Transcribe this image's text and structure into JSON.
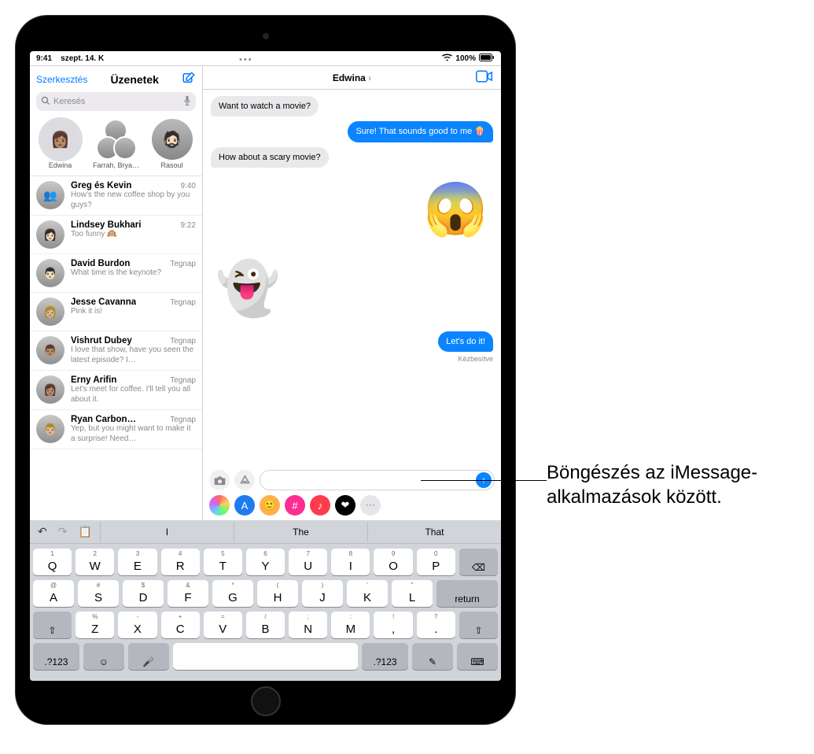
{
  "status": {
    "time": "9:41",
    "date": "szept. 14. K",
    "battery": "100%"
  },
  "sidebar": {
    "edit": "Szerkesztés",
    "title": "Üzenetek",
    "search_placeholder": "Keresés"
  },
  "pinned": [
    {
      "name": "Edwina"
    },
    {
      "name": "Farrah, Brya…"
    },
    {
      "name": "Rasoul"
    }
  ],
  "conversations": [
    {
      "name": "Greg és Kevin",
      "time": "9:40",
      "preview": "How's the new coffee shop by you guys?"
    },
    {
      "name": "Lindsey Bukhari",
      "time": "9:22",
      "preview": "Too funny 🙉"
    },
    {
      "name": "David Burdon",
      "time": "Tegnap",
      "preview": "What time is the keynote?"
    },
    {
      "name": "Jesse Cavanna",
      "time": "Tegnap",
      "preview": "Pink it is!"
    },
    {
      "name": "Vishrut Dubey",
      "time": "Tegnap",
      "preview": "I love that show, have you seen the latest episode? I…"
    },
    {
      "name": "Erny Arifin",
      "time": "Tegnap",
      "preview": "Let's meet for coffee. I'll tell you all about it."
    },
    {
      "name": "Ryan Carbon…",
      "time": "Tegnap",
      "preview": "Yep, but you might want to make it a surprise! Need…"
    }
  ],
  "thread": {
    "title": "Edwina",
    "messages": {
      "m0": "Want to watch a movie?",
      "m1": "Sure! That sounds good to me 🍿",
      "m2": "How about a scary movie?",
      "m3": "Let's do it!"
    },
    "delivered": "Kézbesítve"
  },
  "predict": {
    "p0": "I",
    "p1": "The",
    "p2": "That"
  },
  "keyboard": {
    "row1": [
      {
        "main": "Q",
        "alt": "1"
      },
      {
        "main": "W",
        "alt": "2"
      },
      {
        "main": "E",
        "alt": "3"
      },
      {
        "main": "R",
        "alt": "4"
      },
      {
        "main": "T",
        "alt": "5"
      },
      {
        "main": "Y",
        "alt": "6"
      },
      {
        "main": "U",
        "alt": "7"
      },
      {
        "main": "I",
        "alt": "8"
      },
      {
        "main": "O",
        "alt": "9"
      },
      {
        "main": "P",
        "alt": "0"
      }
    ],
    "row2": [
      {
        "main": "A",
        "alt": "@"
      },
      {
        "main": "S",
        "alt": "#"
      },
      {
        "main": "D",
        "alt": "$"
      },
      {
        "main": "F",
        "alt": "&"
      },
      {
        "main": "G",
        "alt": "*"
      },
      {
        "main": "H",
        "alt": "("
      },
      {
        "main": "J",
        "alt": ")"
      },
      {
        "main": "K",
        "alt": "'"
      },
      {
        "main": "L",
        "alt": "\""
      }
    ],
    "row3": [
      {
        "main": "Z",
        "alt": "%"
      },
      {
        "main": "X",
        "alt": "-"
      },
      {
        "main": "C",
        "alt": "+"
      },
      {
        "main": "V",
        "alt": "="
      },
      {
        "main": "B",
        "alt": "/"
      },
      {
        "main": "N",
        "alt": ";"
      },
      {
        "main": "M",
        "alt": ":"
      }
    ],
    "return": "return",
    "numkey": ".?123"
  },
  "app_drawer_colors": [
    "#ffcf3e",
    "#1f7cf0",
    "#ff5a2e",
    "#ff2d92",
    "#ff3b4e",
    "#000000",
    "#8e8e93"
  ],
  "callout": "Böngészés az iMessage-alkalmazások között."
}
